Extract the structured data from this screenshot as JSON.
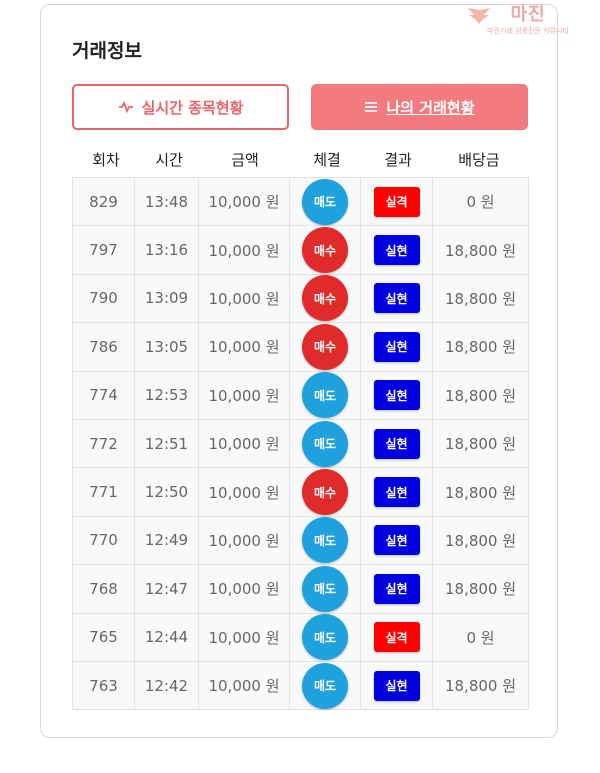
{
  "watermark": {
    "main": "마진",
    "sub": "마진거래 검증전문 커뮤니티"
  },
  "title": "거래정보",
  "buttons": {
    "realtime": "실시간 종목현황",
    "my_trades": "나의 거래현황"
  },
  "columns": [
    "회차",
    "시간",
    "금액",
    "체결",
    "결과",
    "배당금"
  ],
  "colors": {
    "sell": "#1ea1dc",
    "buy": "#e12b2b",
    "loss": "#ff0000",
    "win": "#0000e0",
    "accent": "#f47a7d"
  },
  "rows": [
    {
      "round": "829",
      "time": "13:48",
      "amount": "10,000 원",
      "side": "매도",
      "result": "실격",
      "payout": "0 원"
    },
    {
      "round": "797",
      "time": "13:16",
      "amount": "10,000 원",
      "side": "매수",
      "result": "실현",
      "payout": "18,800 원"
    },
    {
      "round": "790",
      "time": "13:09",
      "amount": "10,000 원",
      "side": "매수",
      "result": "실현",
      "payout": "18,800 원"
    },
    {
      "round": "786",
      "time": "13:05",
      "amount": "10,000 원",
      "side": "매수",
      "result": "실현",
      "payout": "18,800 원"
    },
    {
      "round": "774",
      "time": "12:53",
      "amount": "10,000 원",
      "side": "매도",
      "result": "실현",
      "payout": "18,800 원"
    },
    {
      "round": "772",
      "time": "12:51",
      "amount": "10,000 원",
      "side": "매도",
      "result": "실현",
      "payout": "18,800 원"
    },
    {
      "round": "771",
      "time": "12:50",
      "amount": "10,000 원",
      "side": "매수",
      "result": "실현",
      "payout": "18,800 원"
    },
    {
      "round": "770",
      "time": "12:49",
      "amount": "10,000 원",
      "side": "매도",
      "result": "실현",
      "payout": "18,800 원"
    },
    {
      "round": "768",
      "time": "12:47",
      "amount": "10,000 원",
      "side": "매도",
      "result": "실현",
      "payout": "18,800 원"
    },
    {
      "round": "765",
      "time": "12:44",
      "amount": "10,000 원",
      "side": "매도",
      "result": "실격",
      "payout": "0 원"
    },
    {
      "round": "763",
      "time": "12:42",
      "amount": "10,000 원",
      "side": "매도",
      "result": "실현",
      "payout": "18,800 원"
    }
  ]
}
